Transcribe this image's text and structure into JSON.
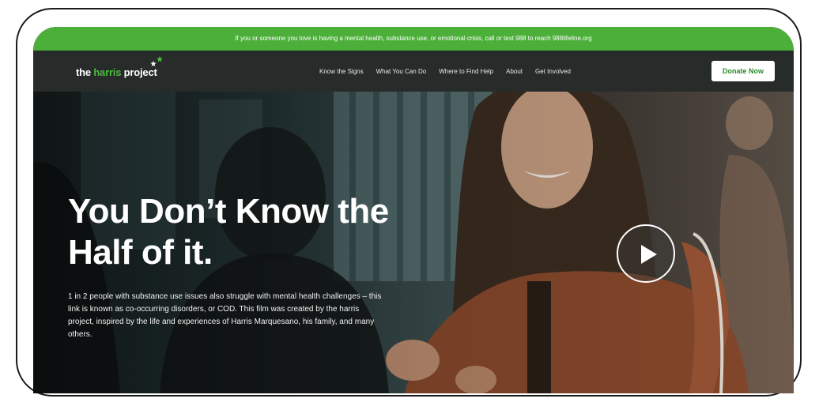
{
  "crisis_banner": {
    "text": "If you or someone you love is having a mental health, substance use, or emotional crisis, call or text 988 to reach 988lifeline.org"
  },
  "header": {
    "logo_prefix": "the ",
    "logo_highlight": "harris",
    "logo_suffix": " project",
    "nav": [
      {
        "label": "Know the Signs"
      },
      {
        "label": "What You Can Do"
      },
      {
        "label": "Where to Find Help"
      },
      {
        "label": "About"
      },
      {
        "label": "Get Involved"
      }
    ],
    "donate_label": "Donate Now"
  },
  "hero": {
    "title_line1": "You Don’t Know the",
    "title_line2": "Half of it.",
    "description": "1 in 2 people with substance use issues also struggle with mental health challenges – this link is known as co-occurring disorders, or COD. This film was created by the harris project, inspired by the life and experiences of Harris Marquesano, his family, and many others.",
    "play_icon": "play-icon"
  },
  "colors": {
    "brand_green": "#4caf3a",
    "nav_bg": "#272b2a",
    "donate_text": "#2b8a2b"
  }
}
